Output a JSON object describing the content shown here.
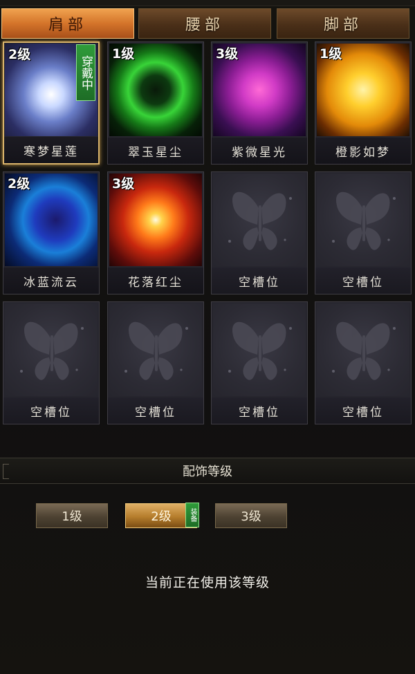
{
  "tabs": [
    "肩部",
    "腰部",
    "脚部"
  ],
  "active_tab": 0,
  "slots": [
    {
      "name": "寒梦星莲",
      "level": "2级",
      "worn": true,
      "art": "lotus"
    },
    {
      "name": "翠玉星尘",
      "level": "1级",
      "worn": false,
      "art": "green"
    },
    {
      "name": "紫微星光",
      "level": "3级",
      "worn": false,
      "art": "purple"
    },
    {
      "name": "橙影如梦",
      "level": "1级",
      "worn": false,
      "art": "sun"
    },
    {
      "name": "冰蓝流云",
      "level": "2级",
      "worn": false,
      "art": "blue"
    },
    {
      "name": "花落红尘",
      "level": "3级",
      "worn": false,
      "art": "red"
    },
    {
      "name": "空槽位",
      "level": "",
      "worn": false,
      "art": "empty"
    },
    {
      "name": "空槽位",
      "level": "",
      "worn": false,
      "art": "empty"
    },
    {
      "name": "空槽位",
      "level": "",
      "worn": false,
      "art": "empty"
    },
    {
      "name": "空槽位",
      "level": "",
      "worn": false,
      "art": "empty"
    },
    {
      "name": "空槽位",
      "level": "",
      "worn": false,
      "art": "empty"
    },
    {
      "name": "空槽位",
      "level": "",
      "worn": false,
      "art": "empty"
    }
  ],
  "wear_tag": "穿戴中",
  "section_title": "配饰等级",
  "levels": [
    "1级",
    "2级",
    "3级"
  ],
  "active_level": 1,
  "equip_tag": "装备",
  "status_text": "当前正在使用该等级"
}
